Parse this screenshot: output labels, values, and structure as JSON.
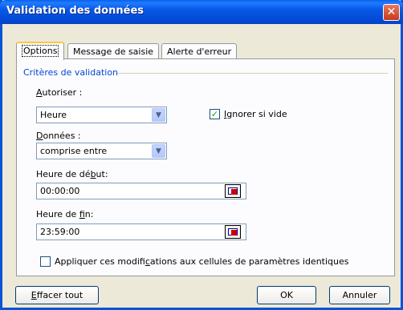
{
  "window": {
    "title": "Validation des données",
    "close_glyph": "✕"
  },
  "tabs": [
    {
      "label": "Options"
    },
    {
      "label": "Message de saisie"
    },
    {
      "label": "Alerte d'erreur"
    }
  ],
  "criteria": {
    "group_label": "Critères de validation",
    "allow_label_pre": "",
    "allow_label_u": "A",
    "allow_label_post": "utoriser :",
    "allow_value": "Heure",
    "ignore_blank_u": "I",
    "ignore_blank_post": "gnorer si vide",
    "ignore_blank_checked": true,
    "data_label_u": "D",
    "data_label_post": "onnées :",
    "data_value": "comprise entre",
    "start_label_pre": "Heure de dé",
    "start_label_u": "b",
    "start_label_post": "ut:",
    "start_value": "00:00:00",
    "end_label_pre": "Heure de ",
    "end_label_u": "f",
    "end_label_post": "in:",
    "end_value": "23:59:00",
    "apply_pre": "Appliquer ces modifi",
    "apply_u": "c",
    "apply_post": "ations aux cellules de paramètres identiques",
    "apply_checked": false
  },
  "buttons": {
    "clear_u": "E",
    "clear_post": "ffacer tout",
    "ok": "OK",
    "cancel": "Annuler"
  },
  "icons": {
    "dropdown": "chevron-down-icon",
    "range_picker": "range-select-icon",
    "checkmark": "✓"
  }
}
